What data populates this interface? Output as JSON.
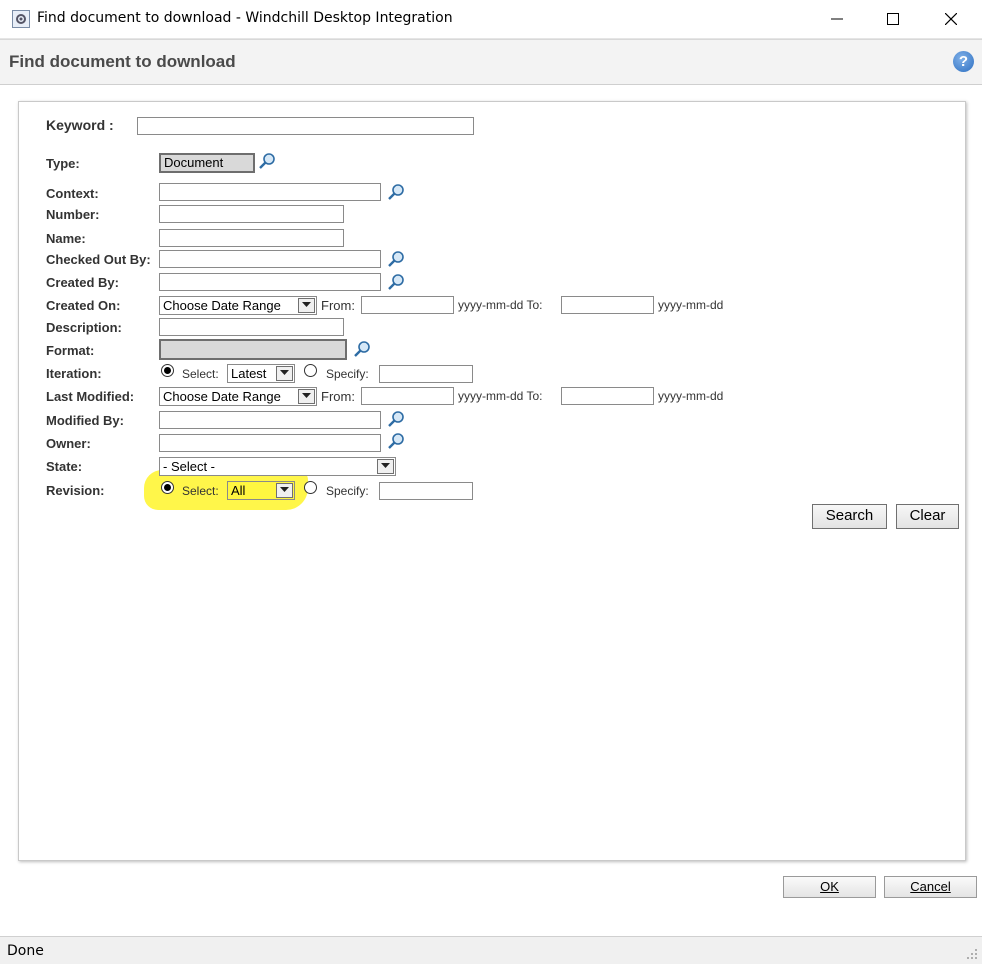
{
  "window": {
    "title": "Find document to download - Windchill Desktop Integration"
  },
  "header": {
    "title": "Find document to download",
    "help_icon": "question-mark-icon"
  },
  "form": {
    "keyword_label": "Keyword :",
    "keyword_value": "",
    "type_label": "Type:",
    "type_value": "Document",
    "context_label": "Context:",
    "number_label": "Number:",
    "name_label": "Name:",
    "checked_out_by_label": "Checked Out By:",
    "created_by_label": "Created By:",
    "created_on_label": "Created On:",
    "created_on_range": "Choose Date Range",
    "from_label": "From:",
    "date_hint_to": "yyyy-mm-dd To:",
    "date_hint": "yyyy-mm-dd",
    "description_label": "Description:",
    "format_label": "Format:",
    "iteration_label": "Iteration:",
    "select_label": "Select:",
    "iteration_select": "Latest",
    "specify_label": "Specify:",
    "last_modified_label": "Last Modified:",
    "last_modified_range": "Choose Date Range",
    "modified_by_label": "Modified By:",
    "owner_label": "Owner:",
    "state_label": "State:",
    "state_select": "- Select -",
    "revision_label": "Revision:",
    "revision_select": "All",
    "search_button": "Search",
    "clear_button": "Clear"
  },
  "dialog": {
    "ok_button": "OK",
    "cancel_button": "Cancel"
  },
  "status": {
    "text": "Done"
  },
  "colors": {
    "highlight": "#fff640",
    "help_blue": "#2d6fc1"
  }
}
